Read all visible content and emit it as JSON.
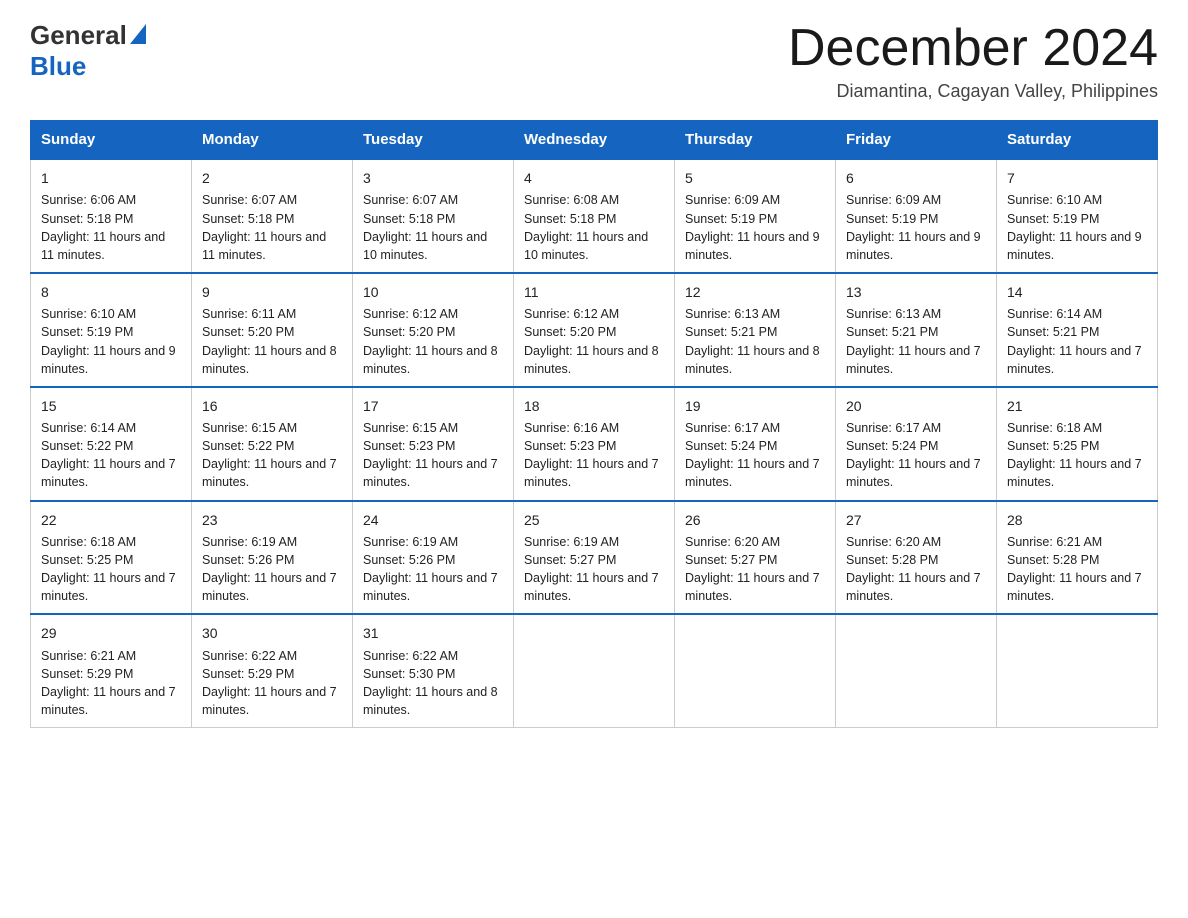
{
  "header": {
    "logo_general": "General",
    "logo_blue": "Blue",
    "month_title": "December 2024",
    "subtitle": "Diamantina, Cagayan Valley, Philippines"
  },
  "calendar": {
    "days_of_week": [
      "Sunday",
      "Monday",
      "Tuesday",
      "Wednesday",
      "Thursday",
      "Friday",
      "Saturday"
    ],
    "weeks": [
      [
        {
          "date": "1",
          "sunrise": "Sunrise: 6:06 AM",
          "sunset": "Sunset: 5:18 PM",
          "daylight": "Daylight: 11 hours and 11 minutes."
        },
        {
          "date": "2",
          "sunrise": "Sunrise: 6:07 AM",
          "sunset": "Sunset: 5:18 PM",
          "daylight": "Daylight: 11 hours and 11 minutes."
        },
        {
          "date": "3",
          "sunrise": "Sunrise: 6:07 AM",
          "sunset": "Sunset: 5:18 PM",
          "daylight": "Daylight: 11 hours and 10 minutes."
        },
        {
          "date": "4",
          "sunrise": "Sunrise: 6:08 AM",
          "sunset": "Sunset: 5:18 PM",
          "daylight": "Daylight: 11 hours and 10 minutes."
        },
        {
          "date": "5",
          "sunrise": "Sunrise: 6:09 AM",
          "sunset": "Sunset: 5:19 PM",
          "daylight": "Daylight: 11 hours and 9 minutes."
        },
        {
          "date": "6",
          "sunrise": "Sunrise: 6:09 AM",
          "sunset": "Sunset: 5:19 PM",
          "daylight": "Daylight: 11 hours and 9 minutes."
        },
        {
          "date": "7",
          "sunrise": "Sunrise: 6:10 AM",
          "sunset": "Sunset: 5:19 PM",
          "daylight": "Daylight: 11 hours and 9 minutes."
        }
      ],
      [
        {
          "date": "8",
          "sunrise": "Sunrise: 6:10 AM",
          "sunset": "Sunset: 5:19 PM",
          "daylight": "Daylight: 11 hours and 9 minutes."
        },
        {
          "date": "9",
          "sunrise": "Sunrise: 6:11 AM",
          "sunset": "Sunset: 5:20 PM",
          "daylight": "Daylight: 11 hours and 8 minutes."
        },
        {
          "date": "10",
          "sunrise": "Sunrise: 6:12 AM",
          "sunset": "Sunset: 5:20 PM",
          "daylight": "Daylight: 11 hours and 8 minutes."
        },
        {
          "date": "11",
          "sunrise": "Sunrise: 6:12 AM",
          "sunset": "Sunset: 5:20 PM",
          "daylight": "Daylight: 11 hours and 8 minutes."
        },
        {
          "date": "12",
          "sunrise": "Sunrise: 6:13 AM",
          "sunset": "Sunset: 5:21 PM",
          "daylight": "Daylight: 11 hours and 8 minutes."
        },
        {
          "date": "13",
          "sunrise": "Sunrise: 6:13 AM",
          "sunset": "Sunset: 5:21 PM",
          "daylight": "Daylight: 11 hours and 7 minutes."
        },
        {
          "date": "14",
          "sunrise": "Sunrise: 6:14 AM",
          "sunset": "Sunset: 5:21 PM",
          "daylight": "Daylight: 11 hours and 7 minutes."
        }
      ],
      [
        {
          "date": "15",
          "sunrise": "Sunrise: 6:14 AM",
          "sunset": "Sunset: 5:22 PM",
          "daylight": "Daylight: 11 hours and 7 minutes."
        },
        {
          "date": "16",
          "sunrise": "Sunrise: 6:15 AM",
          "sunset": "Sunset: 5:22 PM",
          "daylight": "Daylight: 11 hours and 7 minutes."
        },
        {
          "date": "17",
          "sunrise": "Sunrise: 6:15 AM",
          "sunset": "Sunset: 5:23 PM",
          "daylight": "Daylight: 11 hours and 7 minutes."
        },
        {
          "date": "18",
          "sunrise": "Sunrise: 6:16 AM",
          "sunset": "Sunset: 5:23 PM",
          "daylight": "Daylight: 11 hours and 7 minutes."
        },
        {
          "date": "19",
          "sunrise": "Sunrise: 6:17 AM",
          "sunset": "Sunset: 5:24 PM",
          "daylight": "Daylight: 11 hours and 7 minutes."
        },
        {
          "date": "20",
          "sunrise": "Sunrise: 6:17 AM",
          "sunset": "Sunset: 5:24 PM",
          "daylight": "Daylight: 11 hours and 7 minutes."
        },
        {
          "date": "21",
          "sunrise": "Sunrise: 6:18 AM",
          "sunset": "Sunset: 5:25 PM",
          "daylight": "Daylight: 11 hours and 7 minutes."
        }
      ],
      [
        {
          "date": "22",
          "sunrise": "Sunrise: 6:18 AM",
          "sunset": "Sunset: 5:25 PM",
          "daylight": "Daylight: 11 hours and 7 minutes."
        },
        {
          "date": "23",
          "sunrise": "Sunrise: 6:19 AM",
          "sunset": "Sunset: 5:26 PM",
          "daylight": "Daylight: 11 hours and 7 minutes."
        },
        {
          "date": "24",
          "sunrise": "Sunrise: 6:19 AM",
          "sunset": "Sunset: 5:26 PM",
          "daylight": "Daylight: 11 hours and 7 minutes."
        },
        {
          "date": "25",
          "sunrise": "Sunrise: 6:19 AM",
          "sunset": "Sunset: 5:27 PM",
          "daylight": "Daylight: 11 hours and 7 minutes."
        },
        {
          "date": "26",
          "sunrise": "Sunrise: 6:20 AM",
          "sunset": "Sunset: 5:27 PM",
          "daylight": "Daylight: 11 hours and 7 minutes."
        },
        {
          "date": "27",
          "sunrise": "Sunrise: 6:20 AM",
          "sunset": "Sunset: 5:28 PM",
          "daylight": "Daylight: 11 hours and 7 minutes."
        },
        {
          "date": "28",
          "sunrise": "Sunrise: 6:21 AM",
          "sunset": "Sunset: 5:28 PM",
          "daylight": "Daylight: 11 hours and 7 minutes."
        }
      ],
      [
        {
          "date": "29",
          "sunrise": "Sunrise: 6:21 AM",
          "sunset": "Sunset: 5:29 PM",
          "daylight": "Daylight: 11 hours and 7 minutes."
        },
        {
          "date": "30",
          "sunrise": "Sunrise: 6:22 AM",
          "sunset": "Sunset: 5:29 PM",
          "daylight": "Daylight: 11 hours and 7 minutes."
        },
        {
          "date": "31",
          "sunrise": "Sunrise: 6:22 AM",
          "sunset": "Sunset: 5:30 PM",
          "daylight": "Daylight: 11 hours and 8 minutes."
        },
        {
          "date": "",
          "sunrise": "",
          "sunset": "",
          "daylight": ""
        },
        {
          "date": "",
          "sunrise": "",
          "sunset": "",
          "daylight": ""
        },
        {
          "date": "",
          "sunrise": "",
          "sunset": "",
          "daylight": ""
        },
        {
          "date": "",
          "sunrise": "",
          "sunset": "",
          "daylight": ""
        }
      ]
    ]
  }
}
